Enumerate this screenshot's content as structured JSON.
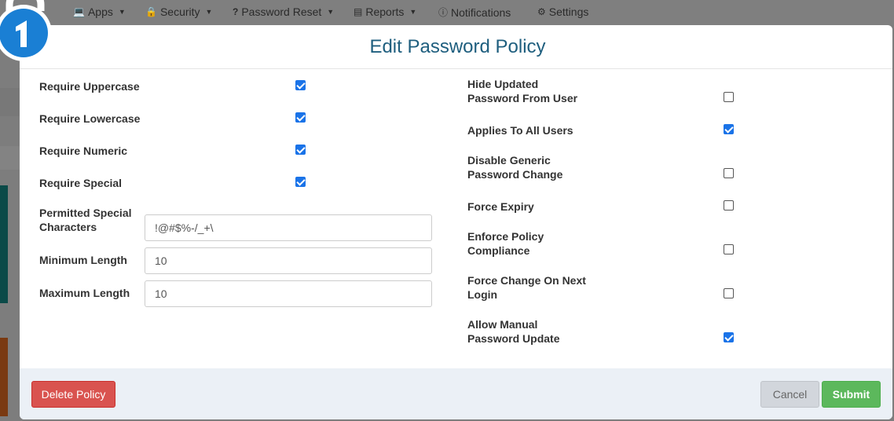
{
  "nav": {
    "items": [
      {
        "label": "Apps",
        "icon": "laptop-icon",
        "dropdown": true
      },
      {
        "label": "Security",
        "icon": "lock-icon",
        "dropdown": true
      },
      {
        "label": "Password Reset",
        "icon": "question-icon",
        "dropdown": true
      },
      {
        "label": "Reports",
        "icon": "report-icon",
        "dropdown": true
      },
      {
        "label": "Notifications",
        "icon": "info-icon",
        "dropdown": false
      },
      {
        "label": "Settings",
        "icon": "gear-icon",
        "dropdown": false
      }
    ]
  },
  "modal": {
    "title": "Edit Password Policy",
    "left": {
      "require_uppercase": {
        "label": "Require Uppercase",
        "checked": true
      },
      "require_lowercase": {
        "label": "Require Lowercase",
        "checked": true
      },
      "require_numeric": {
        "label": "Require Numeric",
        "checked": true
      },
      "require_special": {
        "label": "Require Special",
        "checked": true
      },
      "permitted_special": {
        "label_line1": "Permitted Special",
        "label_line2": "Characters",
        "value": "!@#$%-/_+\\"
      },
      "minimum_length": {
        "label": "Minimum Length",
        "value": "10"
      },
      "maximum_length": {
        "label": "Maximum Length",
        "value": "10"
      }
    },
    "right": {
      "hide_updated": {
        "label_line1": "Hide Updated",
        "label_line2": "Password From User",
        "checked": false
      },
      "applies_all": {
        "label": "Applies To All Users",
        "checked": true
      },
      "disable_generic": {
        "label_line1": "Disable Generic",
        "label_line2": "Password Change",
        "checked": false
      },
      "force_expiry": {
        "label": "Force Expiry",
        "checked": false
      },
      "enforce_policy": {
        "label_line1": "Enforce Policy",
        "label_line2": "Compliance",
        "checked": false
      },
      "force_change": {
        "label_line1": "Force Change On Next",
        "label_line2": "Login",
        "checked": false
      },
      "allow_manual": {
        "label_line1": "Allow Manual",
        "label_line2": "Password Update",
        "checked": true
      }
    },
    "footer": {
      "delete_label": "Delete Policy",
      "cancel_label": "Cancel",
      "submit_label": "Submit"
    }
  },
  "colors": {
    "title": "#1e5e7e",
    "checkbox_on": "#1a73e8",
    "delete": "#d9534f",
    "submit": "#5cb85c",
    "footer_bg": "#ebf0f6"
  }
}
